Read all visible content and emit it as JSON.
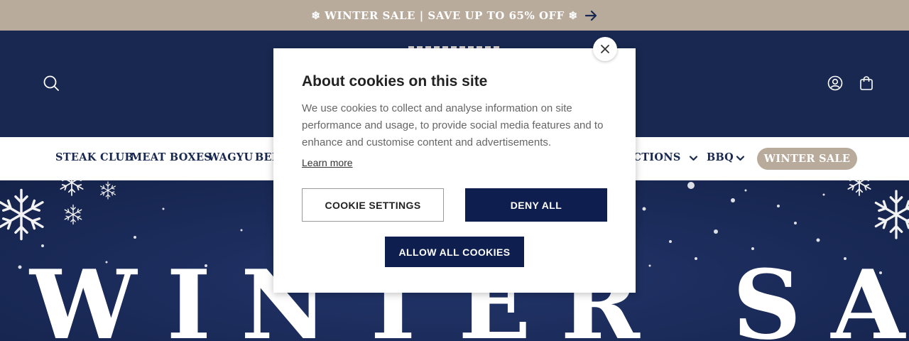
{
  "announcement": {
    "text": "❄ WINTER SALE | SAVE UP TO 65% OFF ❄",
    "icon": "arrow-right-icon"
  },
  "header": {
    "search_icon": "search-icon",
    "account_icon": "account-icon",
    "cart_icon": "cart-icon"
  },
  "nav": {
    "items": [
      {
        "label": "STEAK CLUB"
      },
      {
        "label": "MEAT BOXES"
      },
      {
        "label": "WAGYU"
      },
      {
        "label": "BEE"
      },
      {
        "label": "ECTIONS"
      },
      {
        "label": "BBQ"
      }
    ],
    "sale_pill": "WINTER SALE"
  },
  "hero": {
    "title": "WINTER SALE"
  },
  "cookie_modal": {
    "title": "About cookies on this site",
    "body": "We use cookies to collect and analyse information on site performance and usage, to provide social media features and to enhance and customise content and advertisements.",
    "learn_more": "Learn more",
    "settings_button": "COOKIE SETTINGS",
    "deny_button": "DENY ALL",
    "allow_button": "ALLOW ALL COOKIES",
    "close_icon": "close-icon"
  },
  "colors": {
    "navy": "#182850",
    "beige": "#b9ab9c",
    "button_navy": "#0e1e4e"
  }
}
